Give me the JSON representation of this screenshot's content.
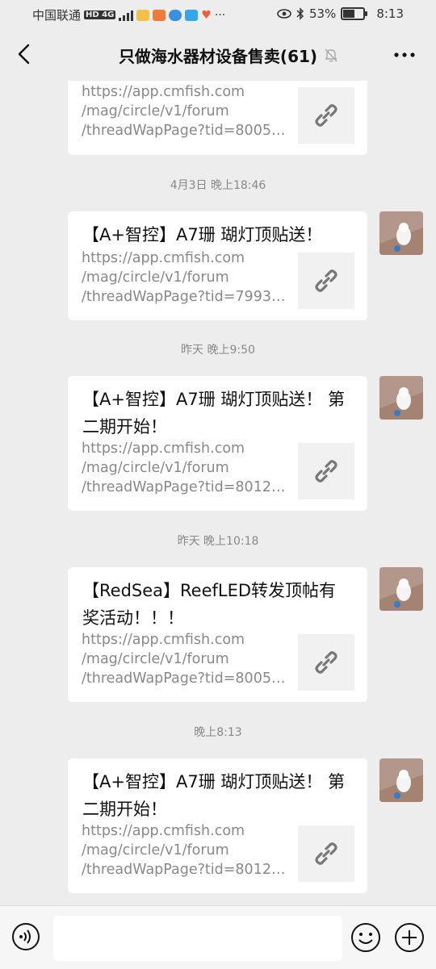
{
  "status_bar": {
    "carrier": "中国联通",
    "network": "HD 4G",
    "battery_percent": "53%",
    "time": "8:13"
  },
  "header": {
    "title": "只做海水器材设备售卖(61)",
    "back_icon": "back-chevron-icon",
    "mute_icon": "bell-off-icon",
    "more_icon": "more-dots-icon"
  },
  "messages": [
    {
      "title": "",
      "url_lines": [
        "https://app.cmfish.com",
        "/mag/circle/v1/forum",
        "/threadWapPage?tid=80054..."
      ]
    },
    {
      "time": "4月3日 晚上18:46",
      "title": "【A+智控】A7珊 瑚灯顶贴送！",
      "url_lines": [
        "https://app.cmfish.com",
        "/mag/circle/v1/forum",
        "/threadWapPage?tid=79930..."
      ]
    },
    {
      "time": "昨天 晚上9:50",
      "title": "【A+智控】A7珊 瑚灯顶贴送！ 第二期开始！",
      "url_lines": [
        "https://app.cmfish.com",
        "/mag/circle/v1/forum",
        "/threadWapPage?tid=80121..."
      ]
    },
    {
      "time": "昨天 晚上10:18",
      "title": "【RedSea】ReefLED转发顶帖有奖活动！！！",
      "url_lines": [
        "https://app.cmfish.com",
        "/mag/circle/v1/forum",
        "/threadWapPage?tid=80054..."
      ]
    },
    {
      "time": "晚上8:13",
      "title": "【A+智控】A7珊 瑚灯顶贴送！ 第二期开始！",
      "url_lines": [
        "https://app.cmfish.com",
        "/mag/circle/v1/forum",
        "/threadWapPage?tid=80121..."
      ]
    }
  ],
  "input_bar": {
    "placeholder": "",
    "voice_icon": "voice-icon",
    "emoji_icon": "emoji-icon",
    "plus_icon": "plus-icon"
  },
  "colors": {
    "background": "#ededed",
    "bubble": "#ffffff",
    "link_gray": "#888888"
  }
}
